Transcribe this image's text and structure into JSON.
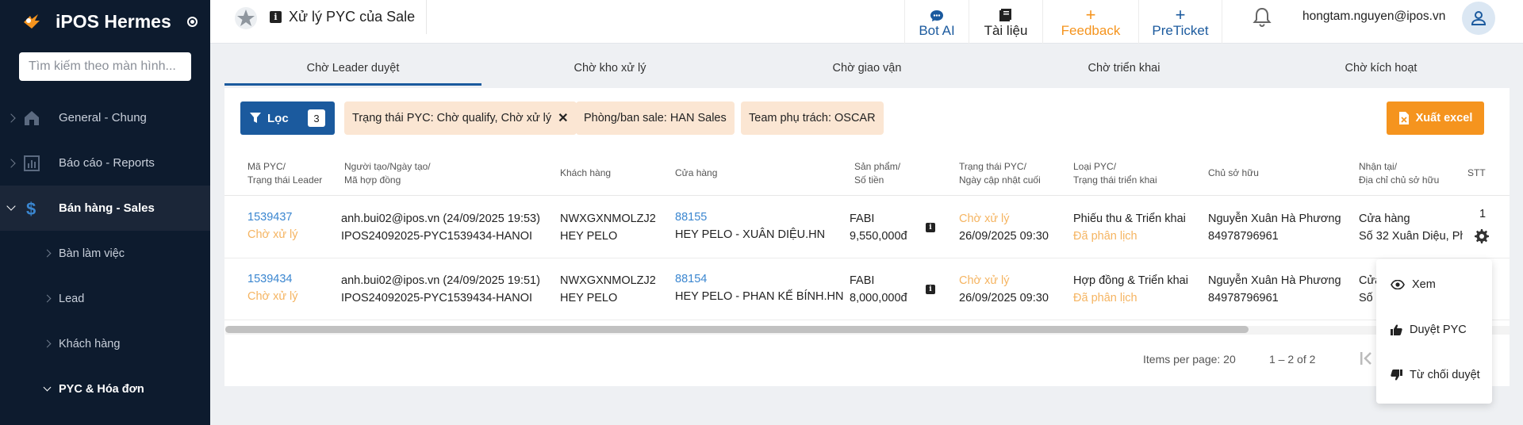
{
  "app": {
    "brand_name": "iPOS Hermes",
    "search_placeholder": "Tìm kiếm theo màn hình..."
  },
  "sidebar": {
    "items": [
      {
        "label": "General - Chung",
        "icon": "home-icon"
      },
      {
        "label": "Báo cáo - Reports",
        "icon": "bar-chart-icon"
      },
      {
        "label": "Bán hàng - Sales",
        "icon": "dollar-icon",
        "active": true
      }
    ],
    "sub_items": [
      {
        "label": "Bàn làm việc"
      },
      {
        "label": "Lead"
      },
      {
        "label": "Khách hàng"
      },
      {
        "label": "PYC & Hóa đơn",
        "active": true
      }
    ]
  },
  "header": {
    "title": "Xử lý PYC của Sale",
    "buttons": [
      {
        "label": "Bot AI",
        "icon": "chat-icon",
        "color": "#1b5a9e"
      },
      {
        "label": "Tài liệu",
        "icon": "book-icon",
        "color": "#222222"
      },
      {
        "label": "Feedback",
        "icon": "plus-icon",
        "color": "#f5941e"
      },
      {
        "label": "PreTicket",
        "icon": "plus-icon",
        "color": "#1b5a9e"
      }
    ],
    "user_email": "hongtam.nguyen@ipos.vn"
  },
  "tabs": [
    {
      "label": "Chờ Leader duyệt",
      "active": true
    },
    {
      "label": "Chờ kho xử lý"
    },
    {
      "label": "Chờ giao vận"
    },
    {
      "label": "Chờ triển khai"
    },
    {
      "label": "Chờ kích hoạt"
    }
  ],
  "filters": {
    "filter_label": "Lọc",
    "filter_count": "3",
    "chips": [
      "Trạng thái PYC: Chờ qualify, Chờ xử lý",
      "Phòng/ban sale: HAN Sales",
      "Team phụ trách: OSCAR"
    ],
    "export_label": "Xuất excel"
  },
  "table": {
    "columns": [
      {
        "line1": "Mã PYC/",
        "line2": "Trạng thái Leader"
      },
      {
        "line1": "Người tạo/Ngày tạo/",
        "line2": "Mã hợp đồng"
      },
      {
        "line1": "Khách hàng",
        "line2": ""
      },
      {
        "line1": "Cửa hàng",
        "line2": ""
      },
      {
        "line1": "Sản phẩm/",
        "line2": "Số tiền"
      },
      {
        "line1": "Trạng thái PYC/",
        "line2": "Ngày cập nhật cuối"
      },
      {
        "line1": "Loại PYC/",
        "line2": "Trạng thái triển khai"
      },
      {
        "line1": "Chủ sở hữu",
        "line2": ""
      },
      {
        "line1": "Nhận tại/",
        "line2": "Địa chỉ chủ sở hữu"
      },
      {
        "line1": "STT",
        "line2": ""
      }
    ],
    "rows": [
      {
        "pyc_id": "1539437",
        "leader_status": "Chờ xử lý",
        "creator": "anh.bui02@ipos.vn (24/09/2025 19:53)",
        "contract": "IPOS24092025-PYC1539434-HANOI",
        "customer_code": "NWXGXNMOLZJ2",
        "customer_name": "HEY PELO",
        "store_id": "88155",
        "store_name": "HEY PELO - XUÂN DIỆU.HN",
        "product": "FABI",
        "amount": "9,550,000đ",
        "pyc_status": "Chờ xử lý",
        "updated": "26/09/2025 09:30",
        "pyc_type": "Phiếu thu & Triển khai",
        "deploy_status": "Đã phân lịch",
        "owner": "Nguyễn Xuân Hà Phương",
        "phone": "84978796961",
        "received_at": "Cửa hàng",
        "address": "Số 32 Xuân Diệu, Ph",
        "stt": "1"
      },
      {
        "pyc_id": "1539434",
        "leader_status": "Chờ xử lý",
        "creator": "anh.bui02@ipos.vn (24/09/2025 19:51)",
        "contract": "IPOS24092025-PYC1539434-HANOI",
        "customer_code": "NWXGXNMOLZJ2",
        "customer_name": "HEY PELO",
        "store_id": "88154",
        "store_name": "HEY PELO - PHAN KẾ BÍNH.HN",
        "product": "FABI",
        "amount": "8,000,000đ",
        "pyc_status": "Chờ xử lý",
        "updated": "26/09/2025 09:30",
        "pyc_type": "Hợp đồng & Triển khai",
        "deploy_status": "Đã phân lịch",
        "owner": "Nguyễn Xuân Hà Phương",
        "phone": "84978796961",
        "received_at": "Cửa",
        "address": "Số 3",
        "stt": ""
      }
    ]
  },
  "pagination": {
    "items_per_page_label": "Items per page: 20",
    "range_label": "1 – 2 of 2"
  },
  "context_menu": {
    "items": [
      {
        "label": "Xem",
        "icon": "eye-icon"
      },
      {
        "label": "Duyệt PYC",
        "icon": "thumbs-up-icon"
      },
      {
        "label": "Từ chối duyệt",
        "icon": "thumbs-down-icon"
      }
    ]
  },
  "colors": {
    "sidebar_bg": "#0d1b2e",
    "primary": "#1b5a9e",
    "accent_orange": "#f5941e",
    "chip_bg": "#fbe6d3",
    "link": "#3a86d0",
    "status_orange": "#f5b461"
  }
}
